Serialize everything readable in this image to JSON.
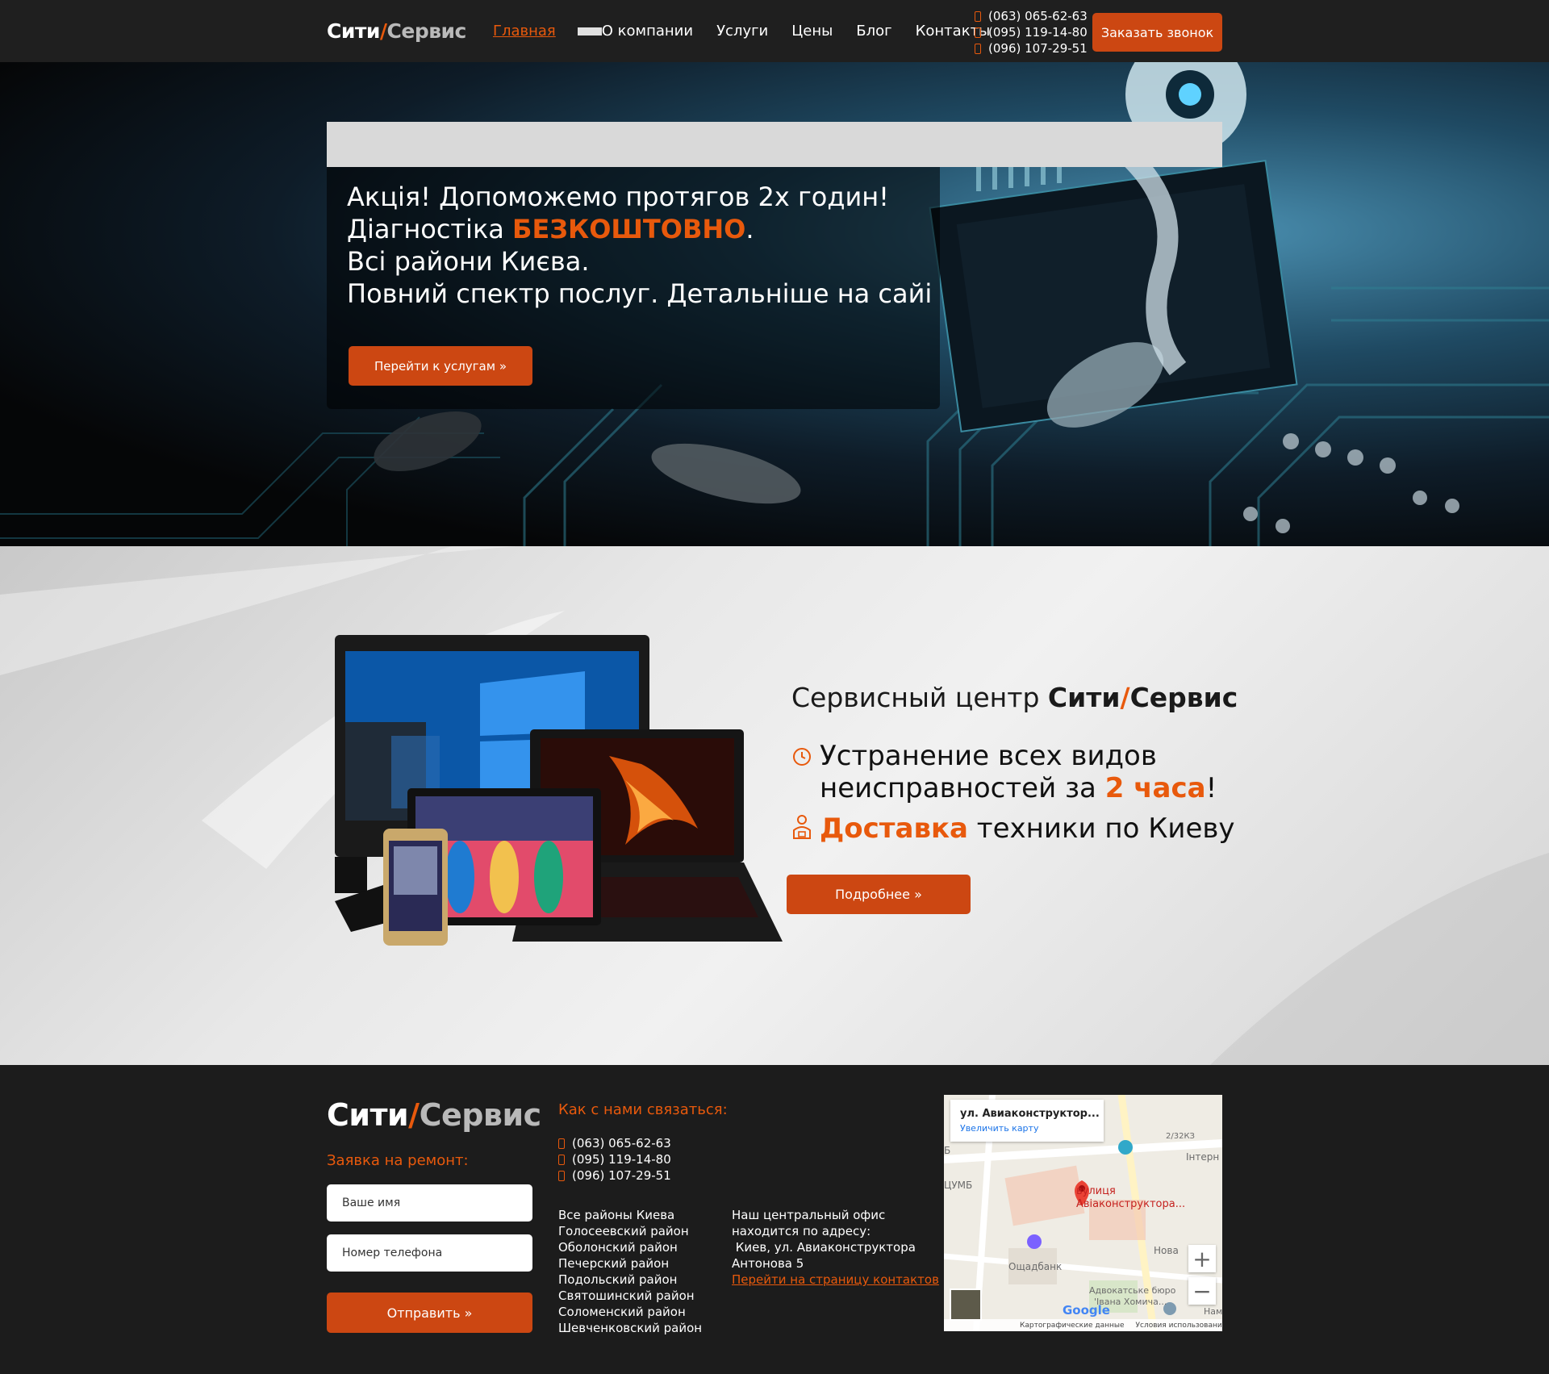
{
  "header": {
    "logo": {
      "part1": "Сити",
      "slash": "/",
      "part2": "Сервис"
    },
    "nav": [
      {
        "label": "Главная",
        "active": true
      },
      {
        "label": "О компании"
      },
      {
        "label": "Услуги"
      },
      {
        "label": "Цены"
      },
      {
        "label": "Блог"
      },
      {
        "label": "Контакты"
      }
    ],
    "phones": [
      "(063) 065-62-63",
      "(095) 119-14-80",
      "(096) 107-29-51"
    ],
    "call_button": "Заказать звонок"
  },
  "hero": {
    "line1": "Акція! Допоможемо протягов 2х годин!",
    "line2_pre": "Діагностіка ",
    "line2_accent": "БЕЗКОШТОВНО",
    "line2_post": ".",
    "line3": "Всі райони Києва.",
    "line4": "Повний спектр послуг. Детальніше на сайі",
    "button": "Перейти к услугам »"
  },
  "service": {
    "title_pre": "Сервисный центр ",
    "brand1": "Сити",
    "brand_slash": "/",
    "brand2": "Сервис",
    "feature1_line1": "Устранение всех видов",
    "feature1_line2_pre": "неисправностей за ",
    "feature1_accent": "2 часа",
    "feature1_post": "!",
    "feature2_accent": "Доставка",
    "feature2_rest": " техники по Киеву",
    "button": "Подробнее »"
  },
  "footer": {
    "logo": {
      "part1": "Сити",
      "slash": "/",
      "part2": "Сервис"
    },
    "request_heading": "Заявка на ремонт:",
    "name_placeholder": "Ваше имя",
    "phone_placeholder": "Номер телефона",
    "send_button": "Отправить »",
    "contact_heading": "Как с нами связаться:",
    "phones": [
      "(063) 065-62-63",
      "(095) 119-14-80",
      "(096) 107-29-51"
    ],
    "districts": [
      "Все районы Киева",
      "Голосеевский район",
      "Оболонский район",
      "Печерский район",
      "Подольский район",
      "Святошинский район",
      "Соломенский район",
      "Шевченковский район"
    ],
    "office_lines": [
      "Наш центральный офис",
      "находится по адресу:",
      " Киев, ул. Авиаконструктора",
      "Антонова 5"
    ],
    "office_link": "Перейти на страницу контактов"
  },
  "map": {
    "card_title": "ул. Авиаконструктор...",
    "card_link": "Увеличить карту",
    "pin_label_1": "вулиця",
    "pin_label_2": "Авіаконструктора...",
    "labels": [
      "Інтерн",
      "ЦУМБ",
      "Ощадбанк",
      "Нова",
      "Адвокатське бюро",
      "'Івана Хомича...",
      "2/32КЗ",
      "Нам",
      "Б"
    ],
    "plus": "+",
    "minus": "−",
    "google": "Google",
    "footer": [
      "Картографические данные",
      "Условия использования"
    ]
  },
  "colors": {
    "accent": "#e8590c",
    "button": "#cc4712",
    "header_bg": "#1f1f1f",
    "footer_bg": "#1c1c1c"
  }
}
